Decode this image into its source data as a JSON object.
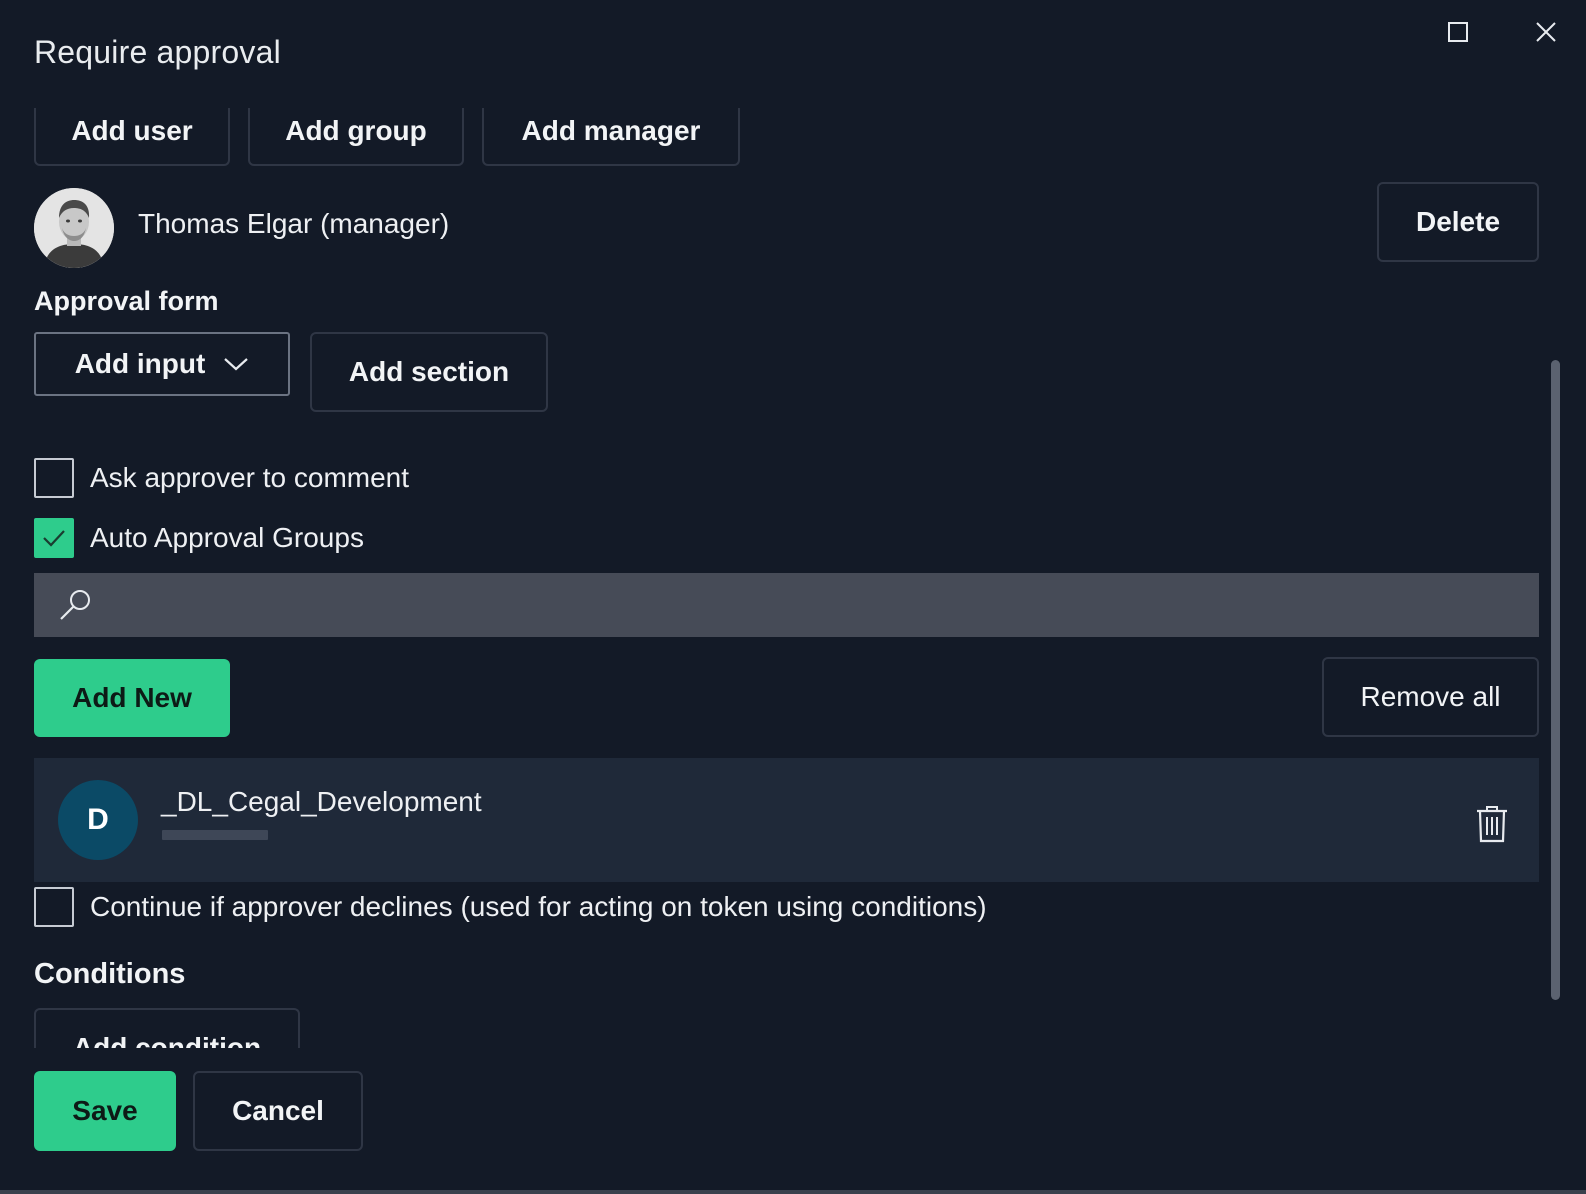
{
  "dialog": {
    "title": "Require approval"
  },
  "approvers": {
    "add_user_label": "Add user",
    "add_group_label": "Add group",
    "add_manager_label": "Add manager",
    "current": {
      "name": "Thomas Elgar (manager)",
      "delete_label": "Delete"
    }
  },
  "approval_form": {
    "heading": "Approval form",
    "add_input_label": "Add input",
    "add_section_label": "Add section"
  },
  "options": {
    "ask_comment_label": "Ask approver to comment",
    "ask_comment_checked": false,
    "auto_approval_label": "Auto Approval Groups",
    "auto_approval_checked": true
  },
  "search": {
    "value": "",
    "icon": "search-icon"
  },
  "groups": {
    "add_new_label": "Add New",
    "remove_all_label": "Remove all",
    "items": [
      {
        "initial": "D",
        "name": "_DL_Cegal_Development"
      }
    ]
  },
  "continue_option": {
    "label": "Continue if approver declines (used for acting on token using conditions)",
    "checked": false
  },
  "conditions": {
    "heading": "Conditions",
    "add_condition_label": "Add condition"
  },
  "footer": {
    "save_label": "Save",
    "cancel_label": "Cancel"
  },
  "colors": {
    "background": "#131a27",
    "accent": "#2ecc8c",
    "card": "#1f2939",
    "search_bg": "#464b57",
    "group_avatar": "#0b4a66"
  }
}
